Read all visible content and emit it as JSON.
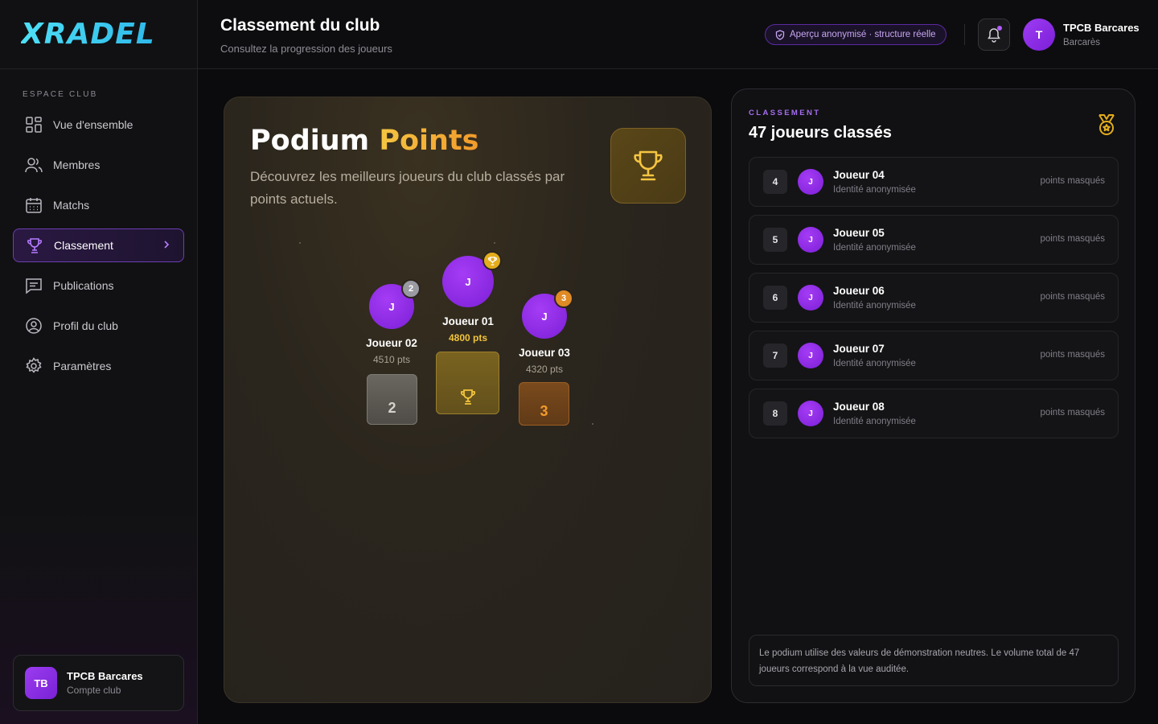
{
  "brand": {
    "logo_text": "XRADEL"
  },
  "sidebar": {
    "section_label": "ESPACE CLUB",
    "items": [
      {
        "label": "Vue d'ensemble",
        "icon": "grid-icon"
      },
      {
        "label": "Membres",
        "icon": "users-icon"
      },
      {
        "label": "Matchs",
        "icon": "calendar-icon"
      },
      {
        "label": "Classement",
        "icon": "trophy-icon",
        "active": true
      },
      {
        "label": "Publications",
        "icon": "message-icon"
      },
      {
        "label": "Profil du club",
        "icon": "user-circle-icon"
      },
      {
        "label": "Paramètres",
        "icon": "gear-icon"
      }
    ],
    "account": {
      "initials": "TB",
      "name": "TPCB Barcares",
      "subtitle": "Compte club"
    }
  },
  "header": {
    "title": "Classement du club",
    "subtitle": "Consultez la progression des joueurs",
    "badge": "Aperçu anonymisé · structure réelle",
    "user": {
      "initial": "T",
      "name": "TPCB Barcares",
      "location": "Barcarès"
    }
  },
  "podium": {
    "title_main": "Podium",
    "title_accent": "Points",
    "description": "Découvrez les meilleurs joueurs du club classés par points actuels.",
    "players": [
      {
        "rank": "2",
        "initial": "J",
        "name": "Joueur 02",
        "points": "4510 pts"
      },
      {
        "rank": "1",
        "initial": "J",
        "name": "Joueur 01",
        "points": "4800 pts"
      },
      {
        "rank": "3",
        "initial": "J",
        "name": "Joueur 03",
        "points": "4320 pts"
      }
    ]
  },
  "ranking": {
    "label": "CLASSEMENT",
    "title": "47 joueurs classés",
    "rows": [
      {
        "rank": "4",
        "initial": "J",
        "name": "Joueur 04",
        "subtitle": "Identité anonymisée",
        "points": "points masqués"
      },
      {
        "rank": "5",
        "initial": "J",
        "name": "Joueur 05",
        "subtitle": "Identité anonymisée",
        "points": "points masqués"
      },
      {
        "rank": "6",
        "initial": "J",
        "name": "Joueur 06",
        "subtitle": "Identité anonymisée",
        "points": "points masqués"
      },
      {
        "rank": "7",
        "initial": "J",
        "name": "Joueur 07",
        "subtitle": "Identité anonymisée",
        "points": "points masqués"
      },
      {
        "rank": "8",
        "initial": "J",
        "name": "Joueur 08",
        "subtitle": "Identité anonymisée",
        "points": "points masqués"
      }
    ],
    "note": "Le podium utilise des valeurs de démonstration neutres. Le volume total de 47 joueurs correspond à la vue auditée."
  },
  "colors": {
    "accent": "#8a2be2",
    "gold": "#f5c542",
    "silver": "#9a9aa2",
    "bronze": "#e08a26",
    "logo": "#3fd6f5"
  }
}
